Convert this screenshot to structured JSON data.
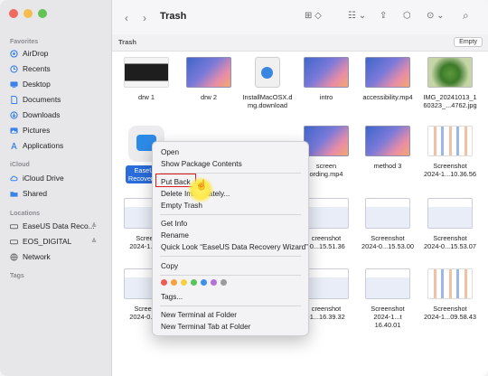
{
  "window": {
    "title": "Trash"
  },
  "traffic_lights": [
    "#ee6a5f",
    "#f5bd4f",
    "#61c454"
  ],
  "sidebar": {
    "favorites_header": "Favorites",
    "favorites": [
      {
        "label": "AirDrop",
        "icon": "airdrop-icon"
      },
      {
        "label": "Recents",
        "icon": "clock-icon"
      },
      {
        "label": "Desktop",
        "icon": "desktop-icon"
      },
      {
        "label": "Documents",
        "icon": "document-icon"
      },
      {
        "label": "Downloads",
        "icon": "download-icon"
      },
      {
        "label": "Pictures",
        "icon": "pictures-icon"
      },
      {
        "label": "Applications",
        "icon": "applications-icon"
      }
    ],
    "icloud_header": "iCloud",
    "icloud": [
      {
        "label": "iCloud Drive",
        "icon": "cloud-icon"
      },
      {
        "label": "Shared",
        "icon": "shared-folder-icon"
      }
    ],
    "locations_header": "Locations",
    "locations": [
      {
        "label": "EaseUS Data Reco...",
        "icon": "disk-icon",
        "eject": "≜"
      },
      {
        "label": "EOS_DIGITAL",
        "icon": "disk-icon",
        "eject": "≜"
      },
      {
        "label": "Network",
        "icon": "network-icon"
      }
    ],
    "tags_header": "Tags"
  },
  "toolbar": {
    "back": "‹",
    "forward": "›",
    "view_icon": "⊞ ◇",
    "group_icon": "☷ ⌄",
    "share_icon": "⇪",
    "tag_icon": "⬡",
    "more_icon": "⊙ ⌄",
    "search_icon": "⌕"
  },
  "pathbar": {
    "label": "Trash",
    "empty_button": "Empty"
  },
  "files": [
    {
      "name": "drw 1",
      "thumb": "dark"
    },
    {
      "name": "drw 2",
      "thumb": "desk"
    },
    {
      "name": "InstallMacOSX.d\nmg.download",
      "thumb": "disk"
    },
    {
      "name": "intro",
      "thumb": "desk"
    },
    {
      "name": "accessibility.mp4",
      "thumb": "desk"
    },
    {
      "name": "IMG_20241013_1\n60323_...4762.jpg",
      "thumb": "plant"
    },
    {
      "name": "EaseUS\nRecovery W",
      "thumb": "app",
      "selected": true
    },
    {
      "name": "",
      "thumb": "hidden"
    },
    {
      "name": "",
      "thumb": "hidden"
    },
    {
      "name": "screen\nording.mp4",
      "thumb": "desk"
    },
    {
      "name": "method 3",
      "thumb": "desk"
    },
    {
      "name": "Screenshot\n2024-1...10.36.56",
      "thumb": "tile"
    },
    {
      "name": "Screen\n2024-1...12",
      "thumb": "app2"
    },
    {
      "name": "",
      "thumb": "hidden"
    },
    {
      "name": "",
      "thumb": "hidden"
    },
    {
      "name": "creenshot\n-0...15.51.36",
      "thumb": "app2"
    },
    {
      "name": "Screenshot\n2024-0...15.53.00",
      "thumb": "app2"
    },
    {
      "name": "Screenshot\n2024-0...15.53.07",
      "thumb": "app2"
    },
    {
      "name": "Screens\n2024-0...15",
      "thumb": "app2"
    },
    {
      "name": "",
      "thumb": "hidden"
    },
    {
      "name": "",
      "thumb": "hidden"
    },
    {
      "name": "creenshot\n-1...16.39.32",
      "thumb": "app2"
    },
    {
      "name": "Screenshot\n2024-1...t 16.40.01",
      "thumb": "app2"
    },
    {
      "name": "Screenshot\n2024-1...09.58.43",
      "thumb": "tile"
    }
  ],
  "context_menu": {
    "open": "Open",
    "show_package": "Show Package Contents",
    "put_back": "Put Back",
    "delete_immediately": "Delete Immediately...",
    "empty_trash": "Empty Trash",
    "get_info": "Get Info",
    "rename": "Rename",
    "quick_look": "Quick Look “EaseUS Data Recovery Wizard”",
    "copy": "Copy",
    "tag_colors": [
      "#ee5b52",
      "#f5a13c",
      "#f5d040",
      "#5ac35a",
      "#3d8ef0",
      "#b56fd6",
      "#9a9a9f"
    ],
    "tags": "Tags...",
    "new_terminal": "New Terminal at Folder",
    "new_terminal_tab": "New Terminal Tab at Folder"
  }
}
